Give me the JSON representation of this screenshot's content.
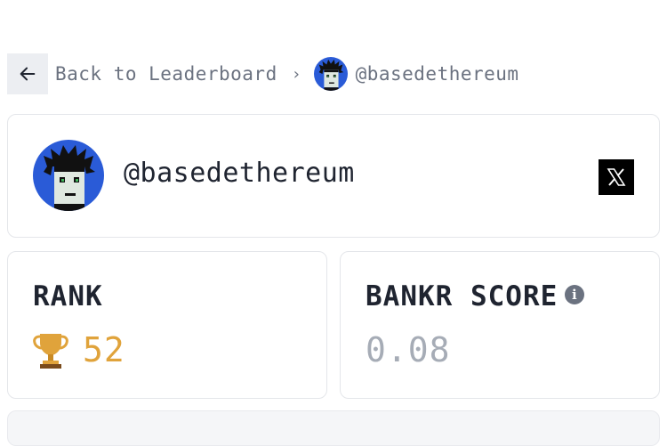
{
  "breadcrumb": {
    "back_label": "Back to Leaderboard",
    "separator": "›",
    "handle": "@basedethereum"
  },
  "profile": {
    "handle": "@basedethereum",
    "social_icon": "x-logo-icon"
  },
  "stats": {
    "rank_label": "RANK",
    "rank_value": "52",
    "score_label": "BANKR SCORE",
    "score_value": "0.08"
  },
  "colors": {
    "rank_accent": "#e0a33b",
    "score_muted": "#a6acb6",
    "avatar_bg": "#2a5bd7"
  }
}
